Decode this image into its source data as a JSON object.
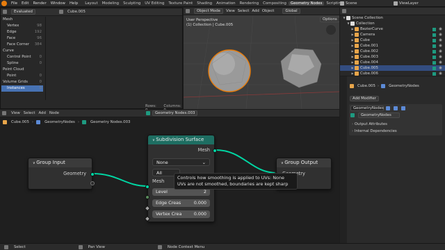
{
  "topbar": {
    "menu": [
      "File",
      "Edit",
      "Render",
      "Window",
      "Help"
    ],
    "workspaces": [
      "Layout",
      "Modeling",
      "Sculpting",
      "UV Editing",
      "Texture Paint",
      "Shading",
      "Animation",
      "Rendering",
      "Compositing",
      "Geometry Nodes",
      "Scripting"
    ],
    "active_workspace": "Geometry Nodes",
    "scene": "Scene",
    "view_layer": "ViewLayer"
  },
  "spreadsheet": {
    "mode": "Evaluated",
    "object": "Cube.005",
    "items": [
      {
        "label": "Mesh",
        "count": ""
      },
      {
        "label": "Vertex",
        "count": "98"
      },
      {
        "label": "Edge",
        "count": "192"
      },
      {
        "label": "Face",
        "count": "96"
      },
      {
        "label": "Face Corner",
        "count": "384"
      },
      {
        "label": "Curve",
        "count": ""
      },
      {
        "label": "Control Point",
        "count": "0"
      },
      {
        "label": "Spline",
        "count": "0"
      },
      {
        "label": "Point Cloud",
        "count": ""
      },
      {
        "label": "Point",
        "count": "0"
      },
      {
        "label": "Volume Grids",
        "count": "0"
      },
      {
        "label": "Instances",
        "count": "0"
      }
    ],
    "rows": "Rows: 0",
    "columns": "Columns: 0"
  },
  "viewport": {
    "mode": "Object Mode",
    "menus": [
      "View",
      "Select",
      "Add",
      "Object"
    ],
    "orientation": "Global",
    "title": "User Perspective",
    "subtitle": "(1) Collection | Cube.005",
    "options": "Options"
  },
  "outliner": {
    "items": [
      {
        "label": "Scene Collection",
        "indent": 0,
        "sel": false
      },
      {
        "label": "Collection",
        "indent": 1,
        "sel": false
      },
      {
        "label": "BezierCurve",
        "indent": 2,
        "sel": false
      },
      {
        "label": "Camera",
        "indent": 2,
        "sel": false
      },
      {
        "label": "Cube",
        "indent": 2,
        "sel": false
      },
      {
        "label": "Cube.001",
        "indent": 2,
        "sel": false
      },
      {
        "label": "Cube.002",
        "indent": 2,
        "sel": false
      },
      {
        "label": "Cube.003",
        "indent": 2,
        "sel": false
      },
      {
        "label": "Cube.004",
        "indent": 2,
        "sel": false
      },
      {
        "label": "Cube.005",
        "indent": 2,
        "sel": true
      },
      {
        "label": "Cube.006",
        "indent": 2,
        "sel": false
      }
    ]
  },
  "properties": {
    "breadcrumb_object": "Cube.005",
    "breadcrumb_modifier": "GeometryNodes",
    "add_modifier": "Add Modifier",
    "modifier_name": "GeometryNodes",
    "node_group": "GeometryNodes",
    "sections": [
      "Output Attributes",
      "Internal Dependencies"
    ]
  },
  "node_editor": {
    "menus": [
      "View",
      "Select",
      "Add",
      "Node"
    ],
    "node_group": "Geometry Nodes.003",
    "breadcrumbs": [
      "Cube.005",
      "GeometryNodes",
      "Geometry Nodes.003"
    ],
    "group_input": {
      "title": "Group Input",
      "output": "Geometry"
    },
    "group_output": {
      "title": "Group Output",
      "input": "Geometry"
    },
    "subdiv": {
      "title": "Subdivision Surface",
      "output": "Mesh",
      "uv_mode": "None",
      "boundary": "All",
      "input": "Mesh",
      "level_label": "Level",
      "level_value": "2",
      "edge_label": "Edge Creas",
      "edge_value": "0.000",
      "vertex_label": "Vertex Crea",
      "vertex_value": "0.000"
    },
    "tooltip_line1": "Controls how smoothing is applied to UVs:  None",
    "tooltip_line2": "UVs are not smoothed, boundaries are kept sharp"
  },
  "status": {
    "select": "Select",
    "pan": "Pan View",
    "context": "Node Context Menu"
  },
  "colors": {
    "accent": "#4772b3",
    "geometry_socket": "#00d6a3",
    "subdiv_header": "#1e6e62",
    "group_header": "#3b3b3b",
    "object_orange": "#e87d0d"
  }
}
